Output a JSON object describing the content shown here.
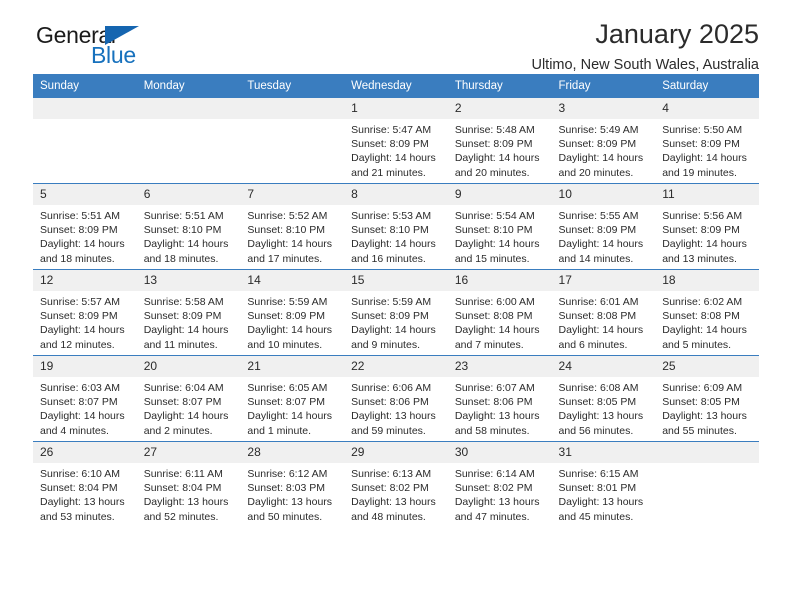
{
  "brand": {
    "name_top": "General",
    "name_bottom": "Blue",
    "accent_color": "#1771bd"
  },
  "header": {
    "title": "January 2025",
    "subtitle": "Ultimo, New South Wales, Australia"
  },
  "calendar": {
    "header_bg": "#3a7dbf",
    "daynum_bg": "#f0f0f0",
    "weekdays": [
      "Sunday",
      "Monday",
      "Tuesday",
      "Wednesday",
      "Thursday",
      "Friday",
      "Saturday"
    ],
    "weeks": [
      [
        {
          "day": "",
          "lines": []
        },
        {
          "day": "",
          "lines": []
        },
        {
          "day": "",
          "lines": []
        },
        {
          "day": "1",
          "lines": [
            "Sunrise: 5:47 AM",
            "Sunset: 8:09 PM",
            "Daylight: 14 hours",
            "and 21 minutes."
          ]
        },
        {
          "day": "2",
          "lines": [
            "Sunrise: 5:48 AM",
            "Sunset: 8:09 PM",
            "Daylight: 14 hours",
            "and 20 minutes."
          ]
        },
        {
          "day": "3",
          "lines": [
            "Sunrise: 5:49 AM",
            "Sunset: 8:09 PM",
            "Daylight: 14 hours",
            "and 20 minutes."
          ]
        },
        {
          "day": "4",
          "lines": [
            "Sunrise: 5:50 AM",
            "Sunset: 8:09 PM",
            "Daylight: 14 hours",
            "and 19 minutes."
          ]
        }
      ],
      [
        {
          "day": "5",
          "lines": [
            "Sunrise: 5:51 AM",
            "Sunset: 8:09 PM",
            "Daylight: 14 hours",
            "and 18 minutes."
          ]
        },
        {
          "day": "6",
          "lines": [
            "Sunrise: 5:51 AM",
            "Sunset: 8:10 PM",
            "Daylight: 14 hours",
            "and 18 minutes."
          ]
        },
        {
          "day": "7",
          "lines": [
            "Sunrise: 5:52 AM",
            "Sunset: 8:10 PM",
            "Daylight: 14 hours",
            "and 17 minutes."
          ]
        },
        {
          "day": "8",
          "lines": [
            "Sunrise: 5:53 AM",
            "Sunset: 8:10 PM",
            "Daylight: 14 hours",
            "and 16 minutes."
          ]
        },
        {
          "day": "9",
          "lines": [
            "Sunrise: 5:54 AM",
            "Sunset: 8:10 PM",
            "Daylight: 14 hours",
            "and 15 minutes."
          ]
        },
        {
          "day": "10",
          "lines": [
            "Sunrise: 5:55 AM",
            "Sunset: 8:09 PM",
            "Daylight: 14 hours",
            "and 14 minutes."
          ]
        },
        {
          "day": "11",
          "lines": [
            "Sunrise: 5:56 AM",
            "Sunset: 8:09 PM",
            "Daylight: 14 hours",
            "and 13 minutes."
          ]
        }
      ],
      [
        {
          "day": "12",
          "lines": [
            "Sunrise: 5:57 AM",
            "Sunset: 8:09 PM",
            "Daylight: 14 hours",
            "and 12 minutes."
          ]
        },
        {
          "day": "13",
          "lines": [
            "Sunrise: 5:58 AM",
            "Sunset: 8:09 PM",
            "Daylight: 14 hours",
            "and 11 minutes."
          ]
        },
        {
          "day": "14",
          "lines": [
            "Sunrise: 5:59 AM",
            "Sunset: 8:09 PM",
            "Daylight: 14 hours",
            "and 10 minutes."
          ]
        },
        {
          "day": "15",
          "lines": [
            "Sunrise: 5:59 AM",
            "Sunset: 8:09 PM",
            "Daylight: 14 hours",
            "and 9 minutes."
          ]
        },
        {
          "day": "16",
          "lines": [
            "Sunrise: 6:00 AM",
            "Sunset: 8:08 PM",
            "Daylight: 14 hours",
            "and 7 minutes."
          ]
        },
        {
          "day": "17",
          "lines": [
            "Sunrise: 6:01 AM",
            "Sunset: 8:08 PM",
            "Daylight: 14 hours",
            "and 6 minutes."
          ]
        },
        {
          "day": "18",
          "lines": [
            "Sunrise: 6:02 AM",
            "Sunset: 8:08 PM",
            "Daylight: 14 hours",
            "and 5 minutes."
          ]
        }
      ],
      [
        {
          "day": "19",
          "lines": [
            "Sunrise: 6:03 AM",
            "Sunset: 8:07 PM",
            "Daylight: 14 hours",
            "and 4 minutes."
          ]
        },
        {
          "day": "20",
          "lines": [
            "Sunrise: 6:04 AM",
            "Sunset: 8:07 PM",
            "Daylight: 14 hours",
            "and 2 minutes."
          ]
        },
        {
          "day": "21",
          "lines": [
            "Sunrise: 6:05 AM",
            "Sunset: 8:07 PM",
            "Daylight: 14 hours",
            "and 1 minute."
          ]
        },
        {
          "day": "22",
          "lines": [
            "Sunrise: 6:06 AM",
            "Sunset: 8:06 PM",
            "Daylight: 13 hours",
            "and 59 minutes."
          ]
        },
        {
          "day": "23",
          "lines": [
            "Sunrise: 6:07 AM",
            "Sunset: 8:06 PM",
            "Daylight: 13 hours",
            "and 58 minutes."
          ]
        },
        {
          "day": "24",
          "lines": [
            "Sunrise: 6:08 AM",
            "Sunset: 8:05 PM",
            "Daylight: 13 hours",
            "and 56 minutes."
          ]
        },
        {
          "day": "25",
          "lines": [
            "Sunrise: 6:09 AM",
            "Sunset: 8:05 PM",
            "Daylight: 13 hours",
            "and 55 minutes."
          ]
        }
      ],
      [
        {
          "day": "26",
          "lines": [
            "Sunrise: 6:10 AM",
            "Sunset: 8:04 PM",
            "Daylight: 13 hours",
            "and 53 minutes."
          ]
        },
        {
          "day": "27",
          "lines": [
            "Sunrise: 6:11 AM",
            "Sunset: 8:04 PM",
            "Daylight: 13 hours",
            "and 52 minutes."
          ]
        },
        {
          "day": "28",
          "lines": [
            "Sunrise: 6:12 AM",
            "Sunset: 8:03 PM",
            "Daylight: 13 hours",
            "and 50 minutes."
          ]
        },
        {
          "day": "29",
          "lines": [
            "Sunrise: 6:13 AM",
            "Sunset: 8:02 PM",
            "Daylight: 13 hours",
            "and 48 minutes."
          ]
        },
        {
          "day": "30",
          "lines": [
            "Sunrise: 6:14 AM",
            "Sunset: 8:02 PM",
            "Daylight: 13 hours",
            "and 47 minutes."
          ]
        },
        {
          "day": "31",
          "lines": [
            "Sunrise: 6:15 AM",
            "Sunset: 8:01 PM",
            "Daylight: 13 hours",
            "and 45 minutes."
          ]
        },
        {
          "day": "",
          "lines": []
        }
      ]
    ]
  }
}
